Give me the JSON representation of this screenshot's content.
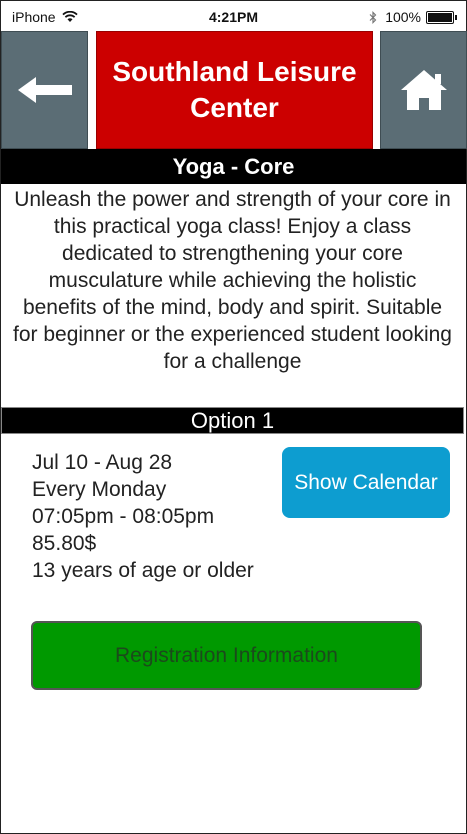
{
  "status_bar": {
    "carrier": "iPhone",
    "time": "4:21PM",
    "battery": "100%"
  },
  "header": {
    "title": "Southland Leisure Center",
    "back_icon": "back-arrow-icon",
    "home_icon": "home-icon"
  },
  "class": {
    "name": "Yoga - Core",
    "description": "Unleash the power and strength of your core in this practical yoga class! Enjoy a class dedicated to strengthening your core musculature while achieving the holistic benefits of the mind, body and spirit. Suitable for beginner or the experienced student looking for a challenge"
  },
  "option": {
    "label": "Option 1",
    "dates": "Jul 10 - Aug 28",
    "day": "Every Monday",
    "time": "07:05pm - 08:05pm",
    "price": "85.80$",
    "age": "13 years of age or older",
    "calendar_button": "Show Calendar"
  },
  "registration_button": "Registration Information",
  "colors": {
    "title_bg": "#cc0000",
    "nav_button_bg": "#5b6d75",
    "calendar_button_bg": "#0d9dd0",
    "registration_button_bg": "#009900"
  }
}
